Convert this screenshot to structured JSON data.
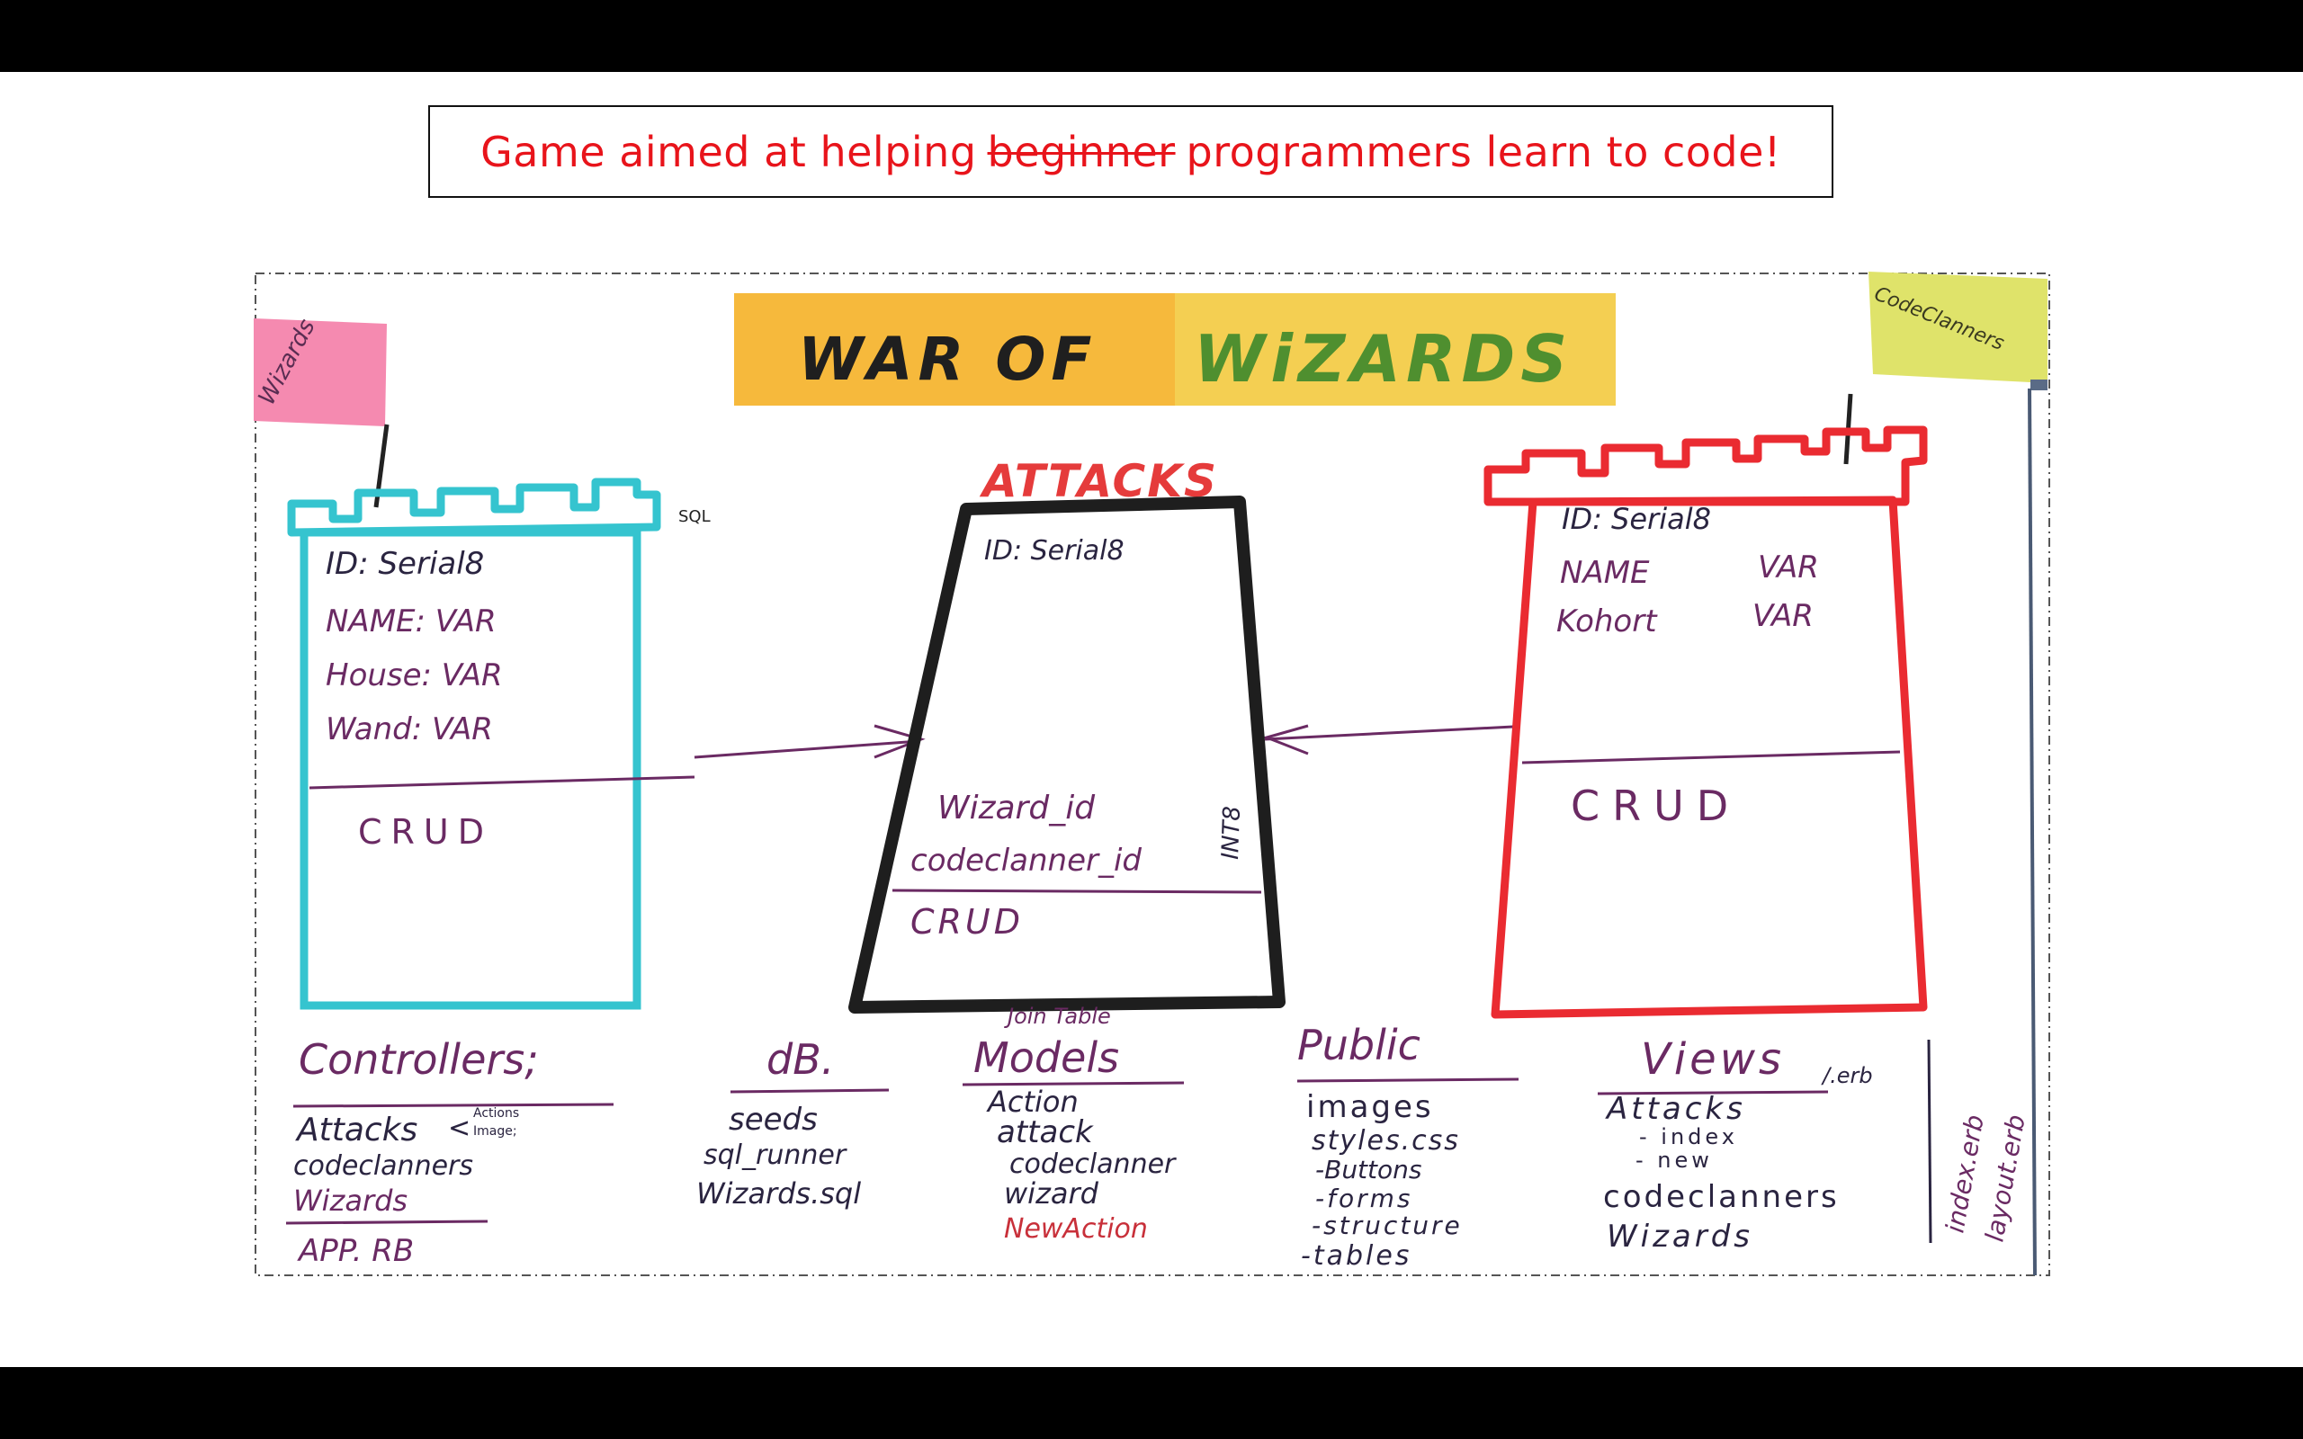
{
  "headline": {
    "before": "Game aimed at helping",
    "struck": "beginner",
    "after": "programmers learn to code!"
  },
  "colors": {
    "headline_red": "#e8141b",
    "wizards_teal": "#35c4cf",
    "attacks_black": "#1e1e1e",
    "codeclanners_red": "#ea2b31",
    "ink_purple": "#6a2a63",
    "ink_dark": "#2a2440",
    "title_orange": "#f6b93c",
    "title_green": "#4f8f2f",
    "sticky_pink": "#f58ab0",
    "sticky_yellow": "#dfe36a"
  },
  "board": {
    "title_part1": "WAR OF",
    "title_part2": "WiZARDS",
    "flag_left": "Wizards",
    "flag_right": "CodeClanners",
    "wizards_table": {
      "fields": [
        "ID: Serial8",
        "NAME: VAR",
        "House: VAR",
        "Wand: VAR"
      ],
      "methods": "CRUD",
      "corner_note": "SQL"
    },
    "attacks_table": {
      "name": "ATTACKS",
      "fields": [
        "ID: Serial8"
      ],
      "foreign_keys": [
        "Wizard_id",
        "codeclanner_id"
      ],
      "fk_type": "INT8",
      "methods": "CRUD"
    },
    "codeclanners_table": {
      "fields": [
        {
          "name": "ID: Serial8",
          "type": ""
        },
        {
          "name": "NAME",
          "type": "VAR"
        },
        {
          "name": "Kohort",
          "type": "VAR"
        }
      ],
      "methods": "CRUD"
    },
    "folders": {
      "controllers": {
        "heading": "Controllers;",
        "items": [
          "Attacks",
          "codeclanners",
          "Wizards"
        ],
        "attacks_note1": "Actions",
        "attacks_note2": "Image;",
        "footer": "APP. RB"
      },
      "db": {
        "heading": "dB.",
        "items": [
          "seeds",
          "sql_runner",
          "Wizards.sql"
        ]
      },
      "models": {
        "note": "Join Table",
        "heading": "Models",
        "items": [
          "Action",
          "attack",
          "codeclanner",
          "wizard"
        ],
        "new_item": "NewAction"
      },
      "public": {
        "heading": "Public",
        "items": [
          "images",
          "styles.css",
          "-Buttons",
          "-forms",
          "-structure",
          "-tables"
        ]
      },
      "views": {
        "heading": "Views",
        "ext": "/.erb",
        "items": [
          "Attacks",
          "- index",
          "- new",
          "codeclanners",
          "Wizards"
        ],
        "side_items": [
          "index.erb",
          "layout.erb"
        ]
      }
    }
  }
}
